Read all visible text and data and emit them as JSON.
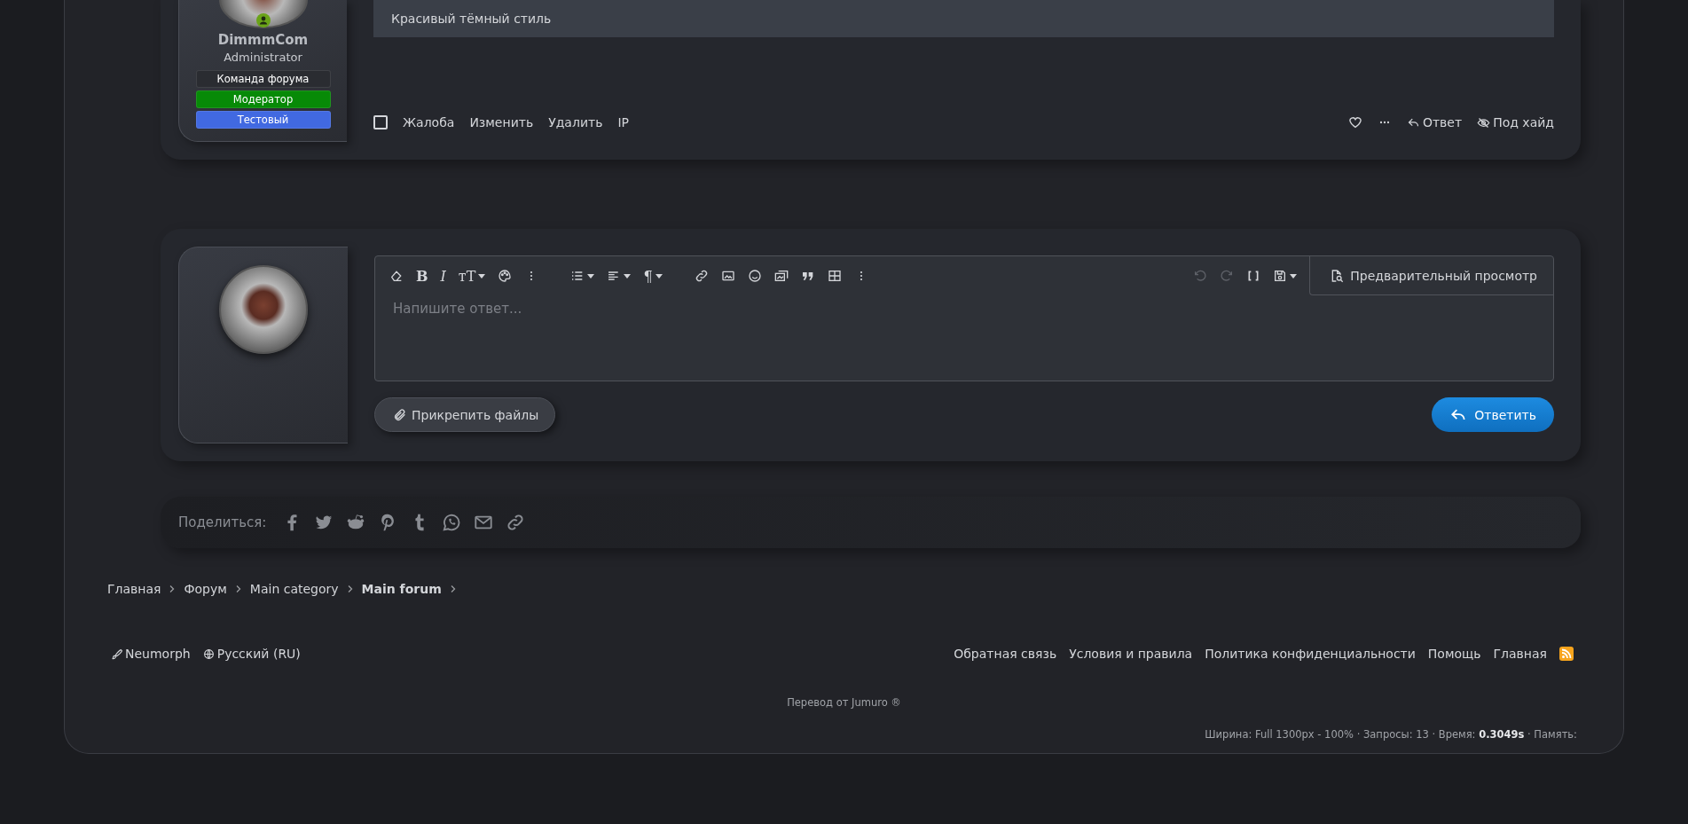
{
  "post": {
    "author": {
      "name": "DimmmCom",
      "title": "Administrator",
      "online": true,
      "banners": [
        {
          "label": "Команда форума",
          "color": "#2a2c31"
        },
        {
          "label": "Модератор",
          "color": "#078a07"
        },
        {
          "label": "Тестовый",
          "color": "#4169e1"
        }
      ]
    },
    "content": "Красивый тёмный стиль",
    "select_checked": false,
    "actions_left": [
      "Жалоба",
      "Изменить",
      "Удалить",
      "IP"
    ],
    "actions_right": [
      {
        "kind": "reply",
        "label": "Ответ"
      },
      {
        "kind": "hide",
        "label": "Под хайд"
      }
    ]
  },
  "editor": {
    "toolbar": [
      {
        "kind": "eraser"
      },
      {
        "kind": "bold",
        "glyph": "B"
      },
      {
        "kind": "italic",
        "glyph": "I"
      },
      {
        "kind": "size",
        "glyph": "тT"
      },
      {
        "kind": "palette"
      },
      {
        "kind": "more"
      },
      {
        "kind": "gap"
      },
      {
        "kind": "list"
      },
      {
        "kind": "align"
      },
      {
        "kind": "paragraph",
        "glyph": "¶"
      },
      {
        "kind": "gap"
      },
      {
        "kind": "link"
      },
      {
        "kind": "image"
      },
      {
        "kind": "smile"
      },
      {
        "kind": "media"
      },
      {
        "kind": "quote"
      },
      {
        "kind": "table"
      },
      {
        "kind": "more"
      }
    ],
    "toolbar_right": [
      {
        "kind": "undo",
        "disabled": true
      },
      {
        "kind": "redo",
        "disabled": true
      },
      {
        "kind": "brackets",
        "disabled": false
      },
      {
        "kind": "drafts",
        "disabled": false
      }
    ],
    "preview_label": "Предварительный просмотр",
    "placeholder": "Напишите ответ...",
    "attach_label": "Прикрепить файлы",
    "submit_label": "Ответить"
  },
  "share": {
    "label": "Поделиться:",
    "items": [
      {
        "kind": "facebook"
      },
      {
        "kind": "twitter"
      },
      {
        "kind": "reddit"
      },
      {
        "kind": "pinterest"
      },
      {
        "kind": "tumblr"
      },
      {
        "kind": "whatsapp"
      },
      {
        "kind": "email"
      },
      {
        "kind": "link"
      }
    ]
  },
  "breadcrumbs": [
    {
      "label": "Главная",
      "current": false
    },
    {
      "label": "Форум",
      "current": false
    },
    {
      "label": "Main category",
      "current": false
    },
    {
      "label": "Main forum",
      "current": true
    }
  ],
  "footer": {
    "style": "Neumorph",
    "language": "Русский (RU)",
    "links": [
      "Обратная связь",
      "Условия и правила",
      "Политика конфиденциальности",
      "Помощь",
      "Главная"
    ],
    "translation": "Перевод от Jumuro ®",
    "stats": "Ширина: Full 1300px - 100% · Запросы: 13 · Время: **0.3049s** · Память:"
  }
}
